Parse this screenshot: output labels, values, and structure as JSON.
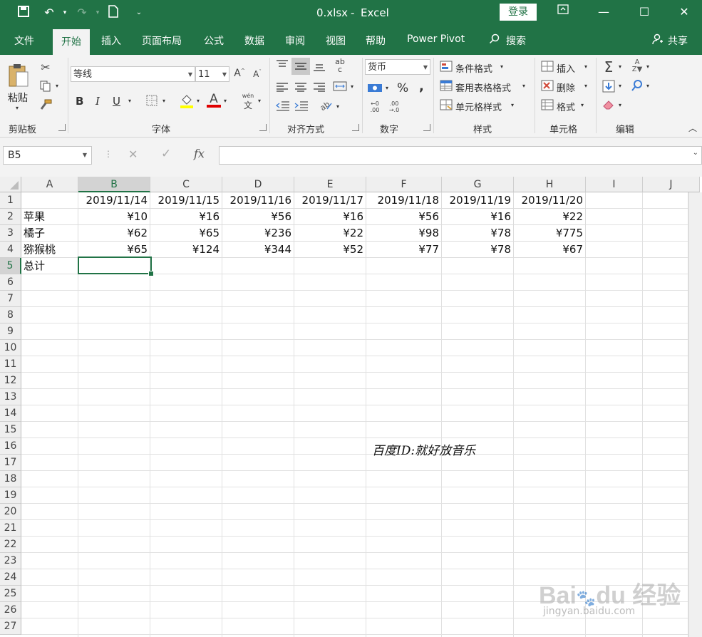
{
  "title": {
    "file": "0.xlsx",
    "sep": "-",
    "app": "Excel",
    "login": "登录"
  },
  "tabs": [
    "文件",
    "开始",
    "插入",
    "页面布局",
    "公式",
    "数据",
    "审阅",
    "视图",
    "帮助",
    "Power Pivot"
  ],
  "search_label": "搜索",
  "share_label": "共享",
  "ribbon": {
    "clipboard": {
      "paste": "粘贴",
      "label": "剪贴板"
    },
    "font": {
      "name": "等线",
      "size": "11",
      "bold": "B",
      "italic": "I",
      "underline": "U",
      "label": "字体"
    },
    "alignment": {
      "label": "对齐方式"
    },
    "number": {
      "format": "货币",
      "percent": "%",
      "comma": ",",
      "label": "数字"
    },
    "styles": {
      "conditional": "条件格式",
      "table": "套用表格格式",
      "cell": "单元格样式",
      "label": "样式"
    },
    "cells": {
      "insert": "插入",
      "delete": "删除",
      "format": "格式",
      "label": "单元格"
    },
    "editing": {
      "label": "编辑"
    }
  },
  "formula_bar": {
    "name_box": "B5",
    "fx": "fx",
    "value": ""
  },
  "columns": [
    "A",
    "B",
    "C",
    "D",
    "E",
    "F",
    "G",
    "H",
    "I",
    "J"
  ],
  "rows": [
    "1",
    "2",
    "3",
    "4",
    "5",
    "6",
    "7",
    "8",
    "9",
    "10",
    "11",
    "12",
    "13",
    "14",
    "15",
    "16",
    "17",
    "18",
    "19",
    "20",
    "21",
    "22",
    "23",
    "24",
    "25",
    "26",
    "27"
  ],
  "sheet": {
    "dates": [
      "2019/11/14",
      "2019/11/15",
      "2019/11/16",
      "2019/11/17",
      "2019/11/18",
      "2019/11/19",
      "2019/11/20"
    ],
    "items": [
      {
        "name": "苹果",
        "values": [
          "¥10",
          "¥16",
          "¥56",
          "¥16",
          "¥56",
          "¥16",
          "¥22"
        ]
      },
      {
        "name": "橘子",
        "values": [
          "¥62",
          "¥65",
          "¥236",
          "¥22",
          "¥98",
          "¥78",
          "¥775"
        ]
      },
      {
        "name": "猕猴桃",
        "values": [
          "¥65",
          "¥124",
          "¥344",
          "¥52",
          "¥77",
          "¥78",
          "¥67"
        ]
      }
    ],
    "total_label": "总计"
  },
  "watermark_text": "百度ID:就好放音乐",
  "baidu_logo": "Bai du 经验",
  "baidu_url": "jingyan.baidu.com",
  "colors": {
    "excel_green": "#217346"
  }
}
